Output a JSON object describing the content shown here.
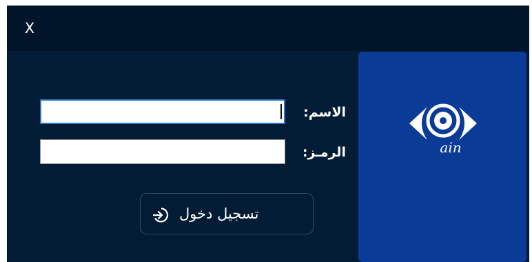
{
  "titlebar": {
    "close_label": "X"
  },
  "form": {
    "name_label": "الاسم:",
    "name_value": "",
    "password_label": "الرمـز:",
    "password_value": "",
    "login_label": "تسجيل دخول"
  },
  "logo": {
    "text": "ain"
  },
  "colors": {
    "window_bg": "#031c35",
    "titlebar_bg": "#01152a",
    "logo_panel": "#0a3b97",
    "focus_border": "#2a74c8"
  },
  "icons": {
    "close": "close-icon",
    "login": "login-arrow-icon",
    "logo": "eye-logo-icon"
  }
}
